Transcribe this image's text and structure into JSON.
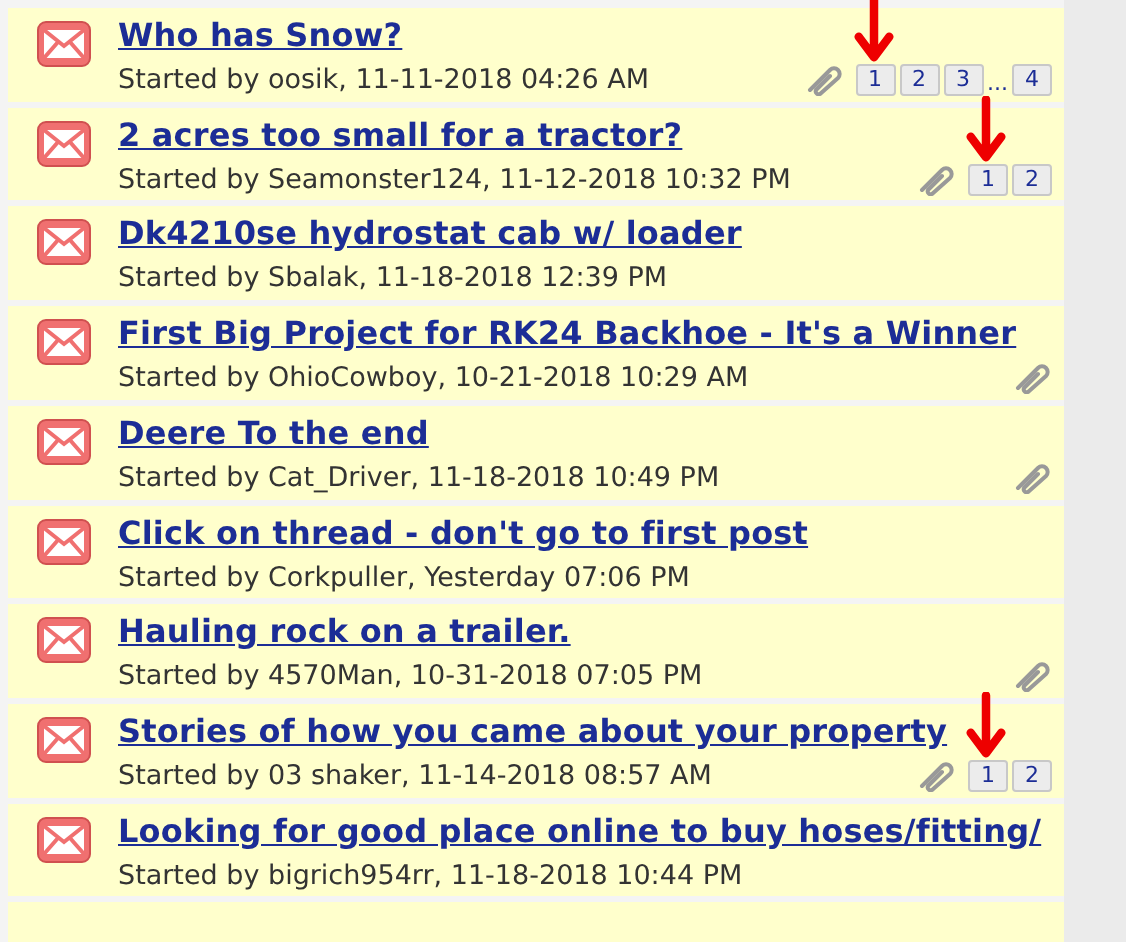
{
  "threads": [
    {
      "title": "Who has Snow?",
      "meta": "Started by oosik, 11-11-2018 04:26 AM",
      "attachment": true,
      "arrow": true,
      "pages": [
        {
          "kind": "page",
          "label": "1"
        },
        {
          "kind": "page",
          "label": "2"
        },
        {
          "kind": "page",
          "label": "3"
        },
        {
          "kind": "gap",
          "label": "..."
        },
        {
          "kind": "page",
          "label": "4"
        }
      ]
    },
    {
      "title": "2 acres too small for a tractor?",
      "meta": "Started by Seamonster124, 11-12-2018 10:32 PM",
      "attachment": true,
      "arrow": true,
      "pages": [
        {
          "kind": "page",
          "label": "1"
        },
        {
          "kind": "page",
          "label": "2"
        }
      ]
    },
    {
      "title": "Dk4210se hydrostat cab w/ loader",
      "meta": "Started by Sbalak, 11-18-2018 12:39 PM",
      "attachment": false,
      "arrow": false
    },
    {
      "title": "First Big Project for RK24 Backhoe - It's a Winner",
      "meta": "Started by OhioCowboy, 10-21-2018 10:29 AM",
      "attachment": true,
      "arrow": false
    },
    {
      "title": "Deere To the end",
      "meta": "Started by Cat_Driver, 11-18-2018 10:49 PM",
      "attachment": true,
      "arrow": false
    },
    {
      "title": "Click on thread - don't go to first post",
      "meta": "Started by Corkpuller, Yesterday 07:06 PM",
      "attachment": false,
      "arrow": false
    },
    {
      "title": "Hauling rock on a trailer.",
      "meta": "Started by 4570Man, 10-31-2018 07:05 PM",
      "attachment": true,
      "arrow": false
    },
    {
      "title": "Stories of how you came about your property",
      "meta": "Started by 03 shaker, 11-14-2018 08:57 AM",
      "attachment": true,
      "arrow": true,
      "pages": [
        {
          "kind": "page",
          "label": "1"
        },
        {
          "kind": "page",
          "label": "2"
        }
      ]
    },
    {
      "title": "Looking for good place online to buy hoses/fitting/",
      "meta": "Started by bigrich954rr, 11-18-2018 10:44 PM",
      "attachment": false,
      "arrow": false
    }
  ]
}
